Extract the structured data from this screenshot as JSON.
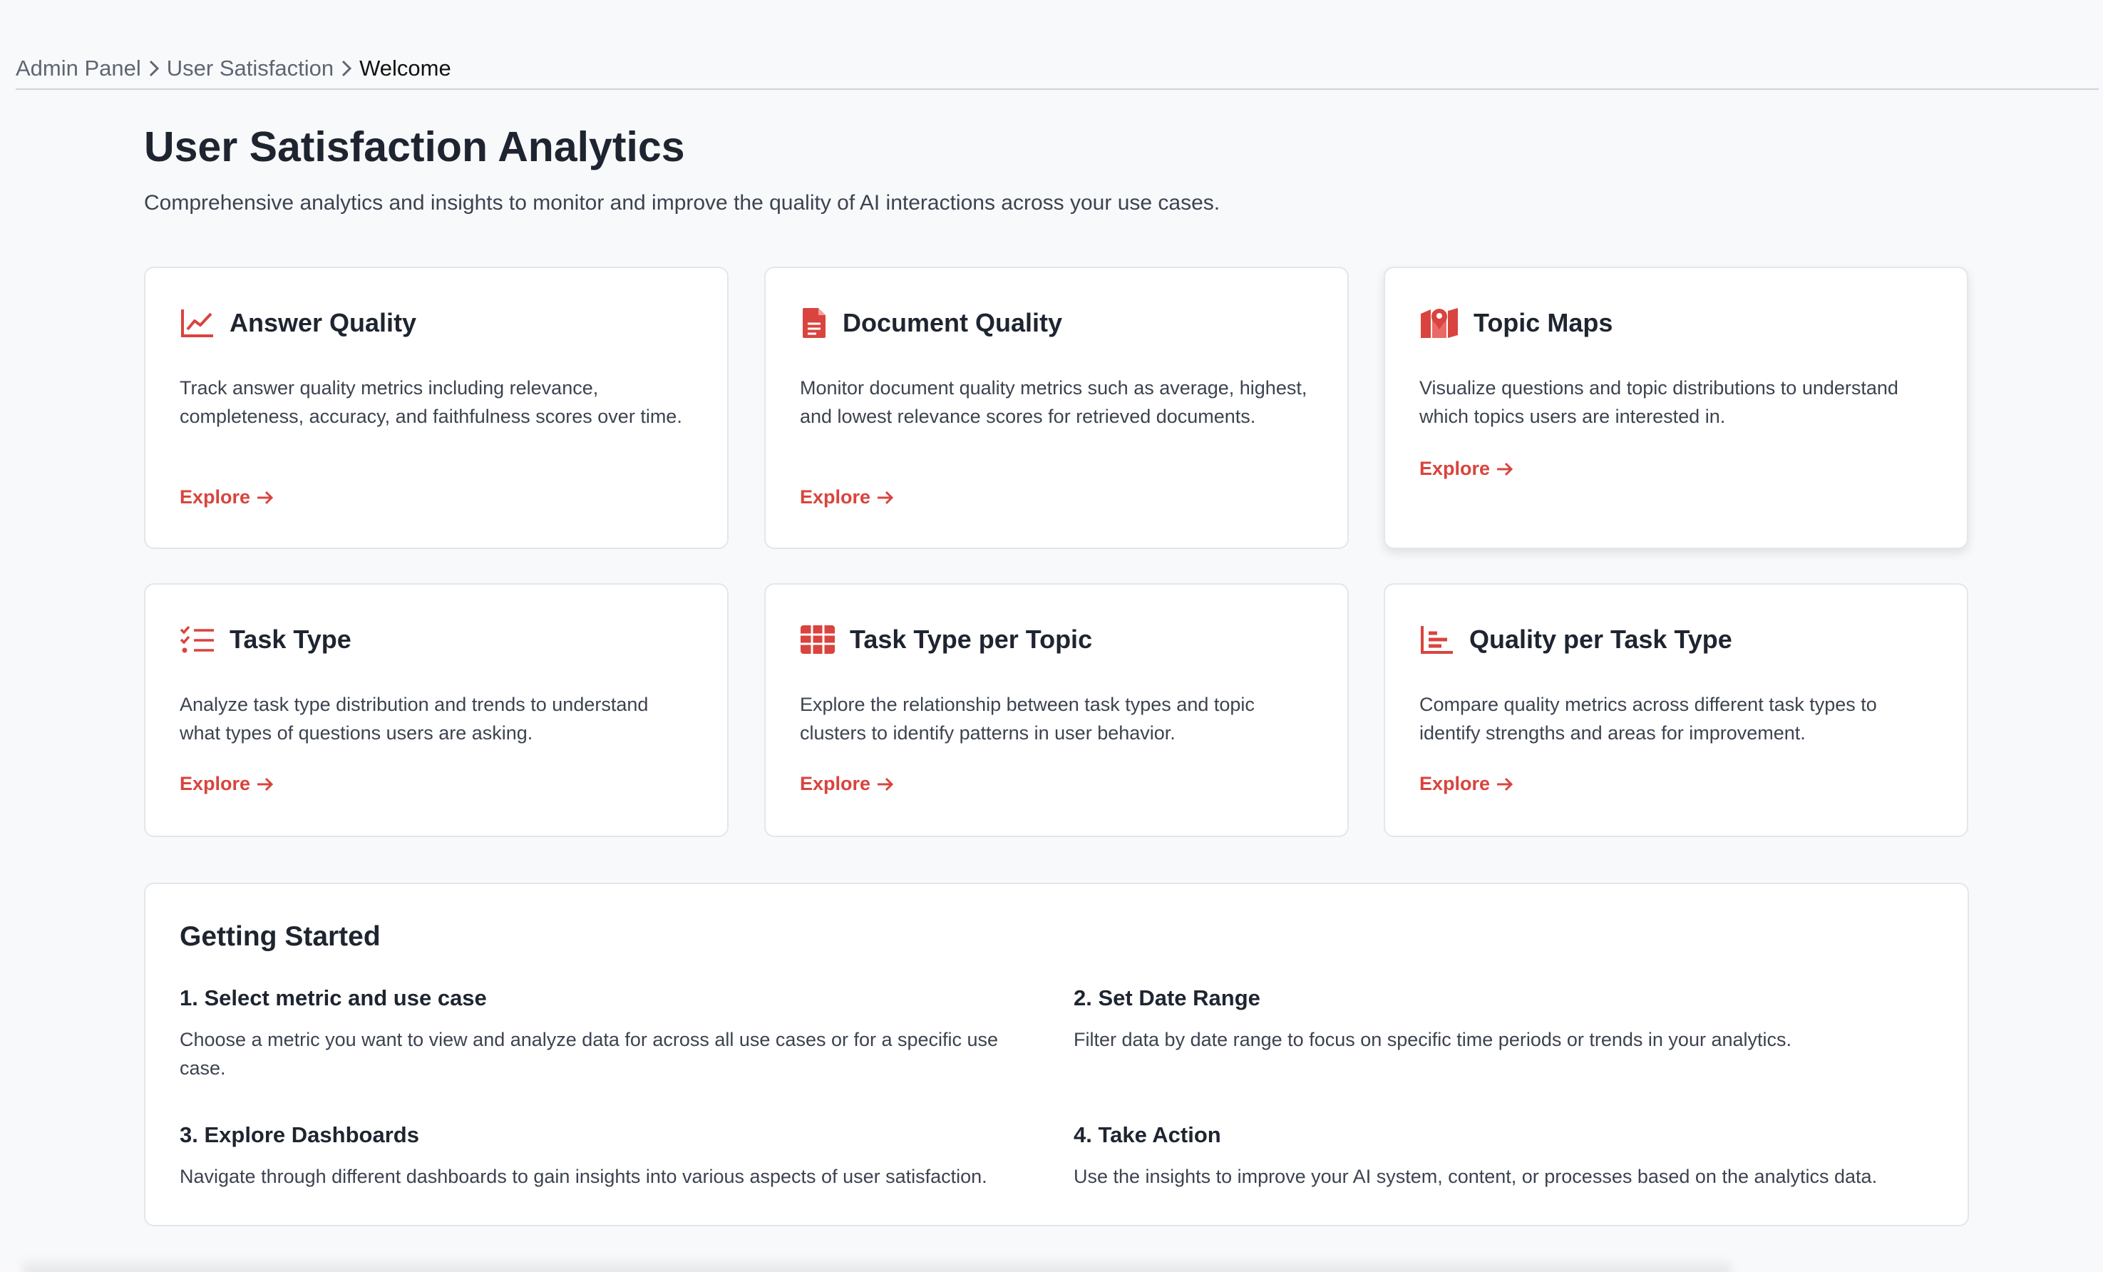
{
  "breadcrumb": {
    "items": [
      "Admin Panel",
      "User Satisfaction",
      "Welcome"
    ]
  },
  "header": {
    "title": "User Satisfaction Analytics",
    "subtitle": "Comprehensive analytics and insights to monitor and improve the quality of AI interactions across your use cases."
  },
  "cards": [
    {
      "title": "Answer Quality",
      "description": "Track answer quality metrics including relevance, completeness, accuracy, and faithfulness scores over time.",
      "link": "Explore",
      "icon": "line-chart-icon"
    },
    {
      "title": "Document Quality",
      "description": "Monitor document quality metrics such as average, highest, and lowest relevance scores for retrieved documents.",
      "link": "Explore",
      "icon": "document-icon"
    },
    {
      "title": "Topic Maps",
      "description": "Visualize questions and topic distributions to understand which topics users are interested in.",
      "link": "Explore",
      "icon": "map-pin-icon"
    },
    {
      "title": "Task Type",
      "description": "Analyze task type distribution and trends to understand what types of questions users are asking.",
      "link": "Explore",
      "icon": "checklist-icon"
    },
    {
      "title": "Task Type per Topic",
      "description": "Explore the relationship between task types and topic clusters to identify patterns in user behavior.",
      "link": "Explore",
      "icon": "table-grid-icon"
    },
    {
      "title": "Quality per Task Type",
      "description": "Compare quality metrics across different task types to identify strengths and areas for improvement.",
      "link": "Explore",
      "icon": "bar-chart-icon"
    }
  ],
  "getting_started": {
    "title": "Getting Started",
    "steps": [
      {
        "title": "1. Select metric and use case",
        "description": "Choose a metric you want to view and analyze data for across all use cases or for a specific use case."
      },
      {
        "title": "2. Set Date Range",
        "description": "Filter data by date range to focus on specific time periods or trends in your analytics."
      },
      {
        "title": "3. Explore Dashboards",
        "description": "Navigate through different dashboards to gain insights into various aspects of user satisfaction."
      },
      {
        "title": "4. Take Action",
        "description": "Use the insights to improve your AI system, content, or processes based on the analytics data."
      }
    ]
  },
  "colors": {
    "accent": "#d9443e",
    "text": "#1e2530",
    "muted": "#3c4350",
    "background": "#f8f9fb"
  }
}
